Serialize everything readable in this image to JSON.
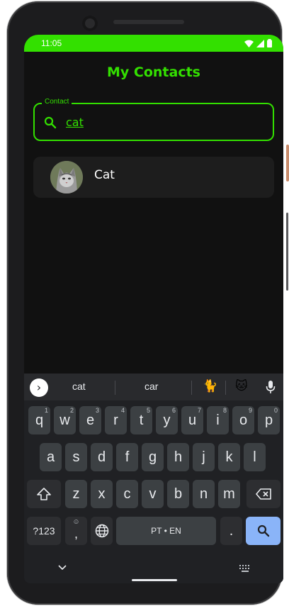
{
  "status_bar": {
    "time": "11:05"
  },
  "app": {
    "title": "My Contacts"
  },
  "search": {
    "label": "Contact",
    "value": "cat"
  },
  "contacts": [
    {
      "name": "Cat"
    }
  ],
  "keyboard": {
    "suggestions": [
      "cat",
      "car"
    ],
    "emoji_suggestions": [
      "🐈",
      "🐱"
    ],
    "row1": [
      {
        "k": "q",
        "h": "1"
      },
      {
        "k": "w",
        "h": "2"
      },
      {
        "k": "e",
        "h": "3"
      },
      {
        "k": "r",
        "h": "4"
      },
      {
        "k": "t",
        "h": "5"
      },
      {
        "k": "y",
        "h": "6"
      },
      {
        "k": "u",
        "h": "7"
      },
      {
        "k": "i",
        "h": "8"
      },
      {
        "k": "o",
        "h": "9"
      },
      {
        "k": "p",
        "h": "0"
      }
    ],
    "row2": [
      "a",
      "s",
      "d",
      "f",
      "g",
      "h",
      "j",
      "k",
      "l"
    ],
    "row3": [
      "z",
      "x",
      "c",
      "v",
      "b",
      "n",
      "m"
    ],
    "symbols_label": "?123",
    "comma_label": ",",
    "space_label": "PT • EN",
    "period_label": "."
  },
  "colors": {
    "accent": "#33e000",
    "background": "#111111",
    "card": "#1d1d1d"
  }
}
